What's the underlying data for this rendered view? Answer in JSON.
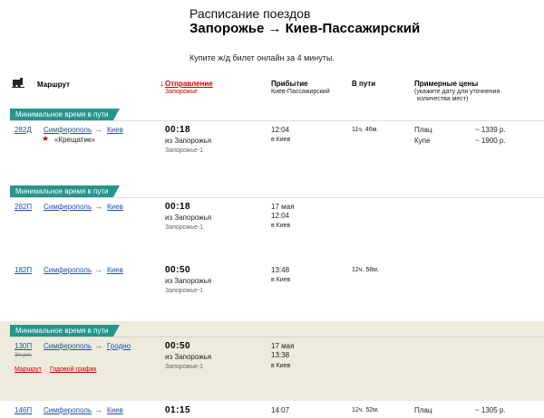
{
  "header": {
    "title": "Расписание поездов",
    "route": "Запорожье → Киев-Пассажирский",
    "subtitle": "Купите ж/д билет онлайн за 4 минуты."
  },
  "columns": {
    "route": "Маршрут",
    "departure_arrow": "↓",
    "departure": "Отправление",
    "departure_sub": "Запорожье",
    "arrival": "Прибытие",
    "arrival_sub": "Киев-Пассажирский",
    "duration": "В пути",
    "prices": "Примерные цены",
    "prices_sub1": "(укажите дату для уточнения",
    "prices_sub2": "количества мест)"
  },
  "badge_label": "Минимальное время в пути",
  "trains": [
    {
      "number": "282Д",
      "from": "Симферополь",
      "arrow": "→",
      "to": "Киев",
      "name": "«Крещатик»",
      "dep_time": "00:18",
      "dep_from": "из Запорожья",
      "dep_station": "Запорожье-1",
      "arr_time": "12:04",
      "arr_to": "в Киев",
      "duration": "11ч. 46м.",
      "price1_class": "Плац",
      "price1": "~ 1339 р.",
      "price2_class": "Купе",
      "price2": "~ 1900 р."
    },
    {
      "number": "282П",
      "from": "Симферополь",
      "arrow": "→",
      "to": "Киев",
      "dep_time": "00:18",
      "dep_from": "из Запорожья",
      "dep_station": "Запорожье-1",
      "arr_date": "17 мая",
      "arr_time": "12:04",
      "arr_to": "в Киев"
    },
    {
      "number": "182П",
      "from": "Симферополь",
      "arrow": "→",
      "to": "Киев",
      "dep_time": "00:50",
      "dep_from": "из Запорожья",
      "dep_station": "Запорожье-1",
      "arr_time": "13:48",
      "arr_to": "в Киев",
      "duration": "12ч. 58м."
    },
    {
      "number": "130П",
      "from": "Симферополь",
      "arrow": "→",
      "to": "Гродно",
      "note": "Эл.рег.",
      "dep_time": "00:50",
      "dep_from": "из Запорожья",
      "dep_station": "Запорожье-1",
      "arr_date": "17 мая",
      "arr_time": "13:38",
      "arr_to": "в Киев",
      "link_route": "Маршрут",
      "link_schedule": "Годовой график"
    },
    {
      "number": "146П",
      "from": "Симферополь",
      "arrow": "→",
      "to": "Киев",
      "dep_time": "01:15",
      "arr_time": "14:07",
      "duration": "12ч. 52м.",
      "price1_class": "Плац",
      "price1": "~ 1305 р."
    }
  ]
}
